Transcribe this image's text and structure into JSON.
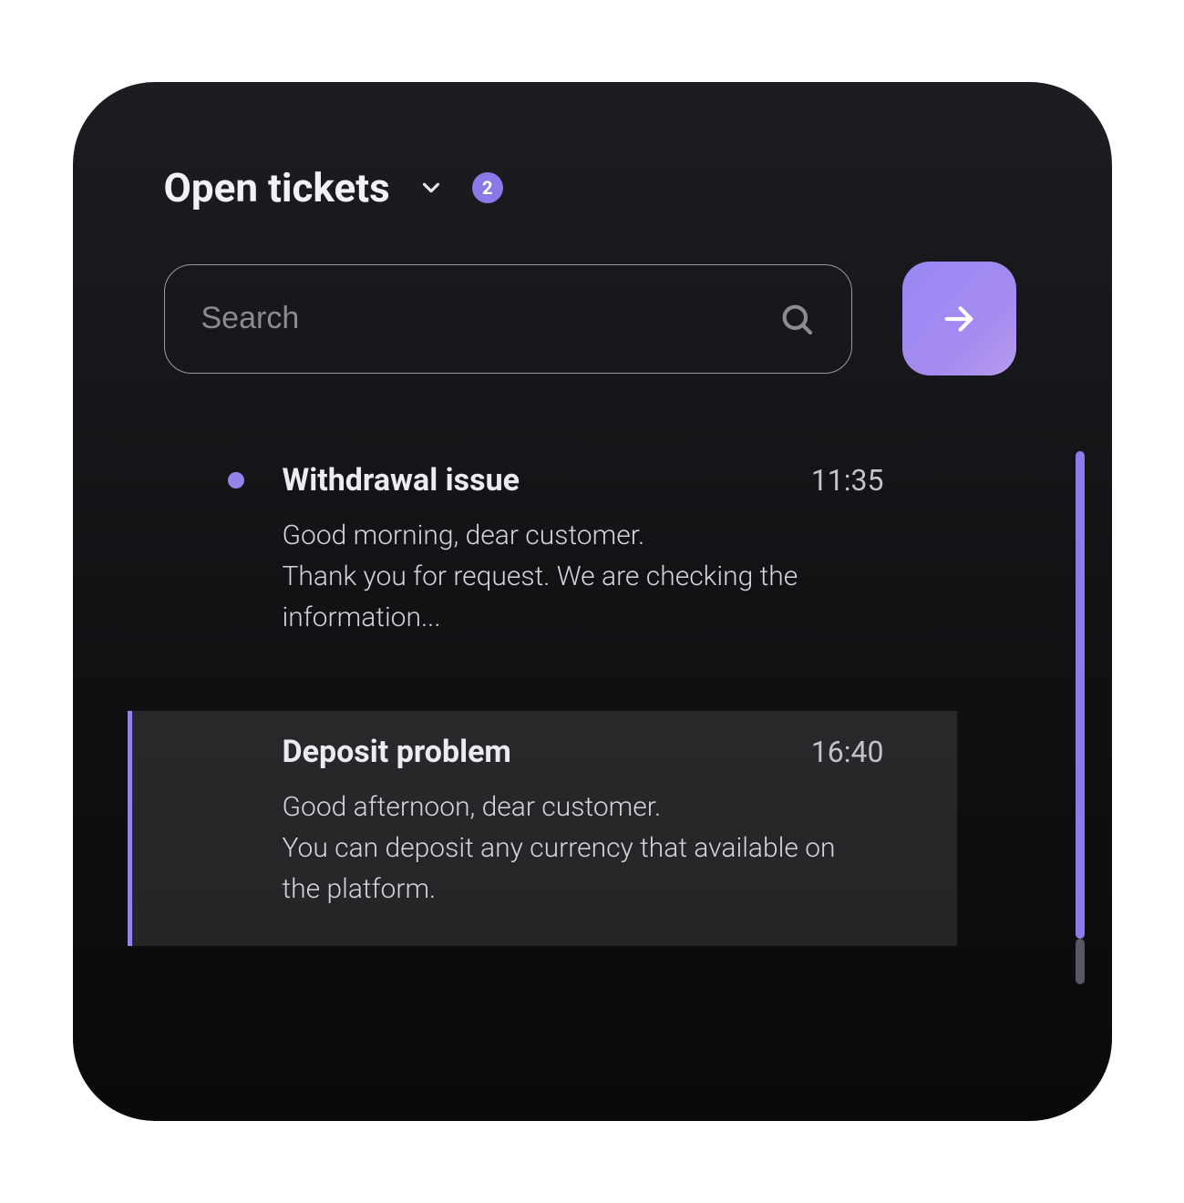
{
  "colors": {
    "accent": "#8c7bea",
    "badge": "#8a79e6"
  },
  "header": {
    "title": "Open tickets",
    "badge_count": "2"
  },
  "search": {
    "placeholder": "Search"
  },
  "tickets": [
    {
      "unread": true,
      "title": "Withdrawal issue",
      "time": "11:35",
      "preview": "Good morning, dear customer.\nThank you for request. We are checking the information...",
      "selected": false
    },
    {
      "unread": false,
      "title": "Deposit problem",
      "time": "16:40",
      "preview": "Good afternoon, dear customer.\nYou can deposit any currency that available on the platform.",
      "selected": true
    }
  ]
}
